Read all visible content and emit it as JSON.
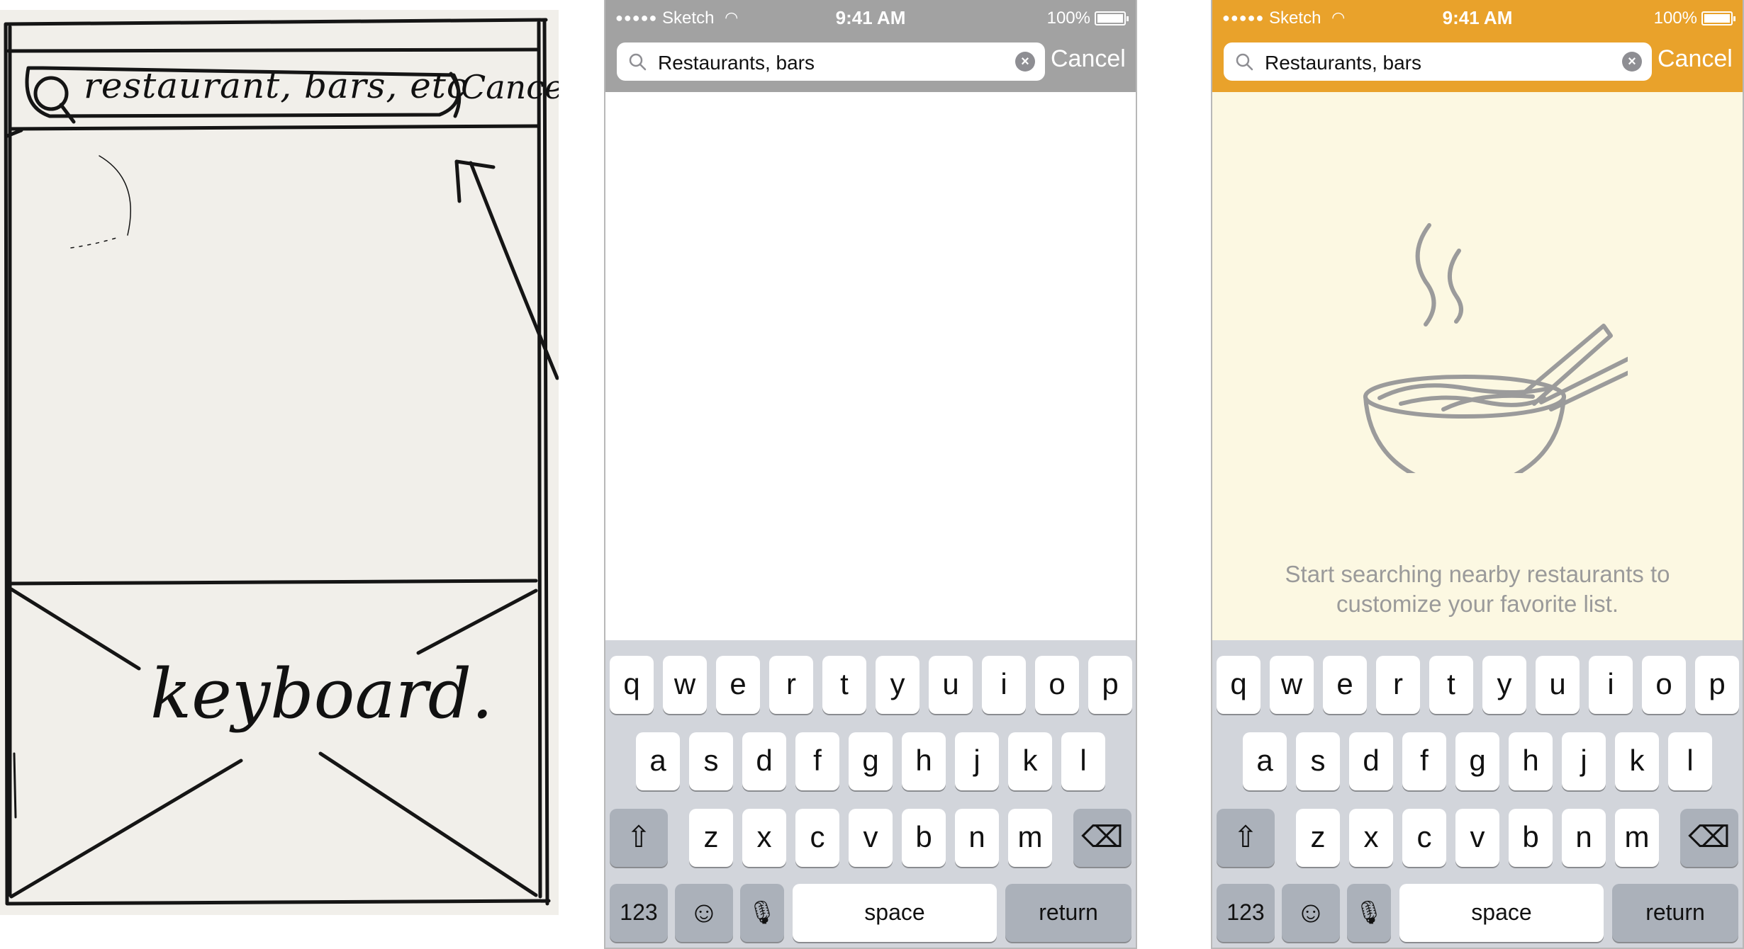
{
  "sketch": {
    "search_text": "restaurant, bars, etc",
    "cancel_text": "Cancel",
    "keyboard_text": "keyboard."
  },
  "screens": {
    "gray": {
      "status": {
        "carrier": "Sketch",
        "signal_dots": "●●●●●",
        "time": "9:41 AM",
        "battery": "100%"
      },
      "search": {
        "value": "Restaurants, bars"
      },
      "cancel_label": "Cancel"
    },
    "orange": {
      "status": {
        "carrier": "Sketch",
        "signal_dots": "●●●●●",
        "time": "9:41 AM",
        "battery": "100%"
      },
      "search": {
        "value": "Restaurants, bars"
      },
      "cancel_label": "Cancel",
      "empty_message_line1": "Start searching nearby restaurants to",
      "empty_message_line2": "customize your favorite list."
    }
  },
  "keyboard": {
    "row1": [
      "q",
      "w",
      "e",
      "r",
      "t",
      "y",
      "u",
      "i",
      "o",
      "p"
    ],
    "row2": [
      "a",
      "s",
      "d",
      "f",
      "g",
      "h",
      "j",
      "k",
      "l"
    ],
    "row3": [
      "z",
      "x",
      "c",
      "v",
      "b",
      "n",
      "m"
    ],
    "shift_glyph": "⇧",
    "delete_glyph": "⌫",
    "numbers_label": "123",
    "emoji_glyph": "☺",
    "mic_glyph": "🎙",
    "space_label": "space",
    "return_label": "return"
  },
  "colors": {
    "gray_header": "#a2a2a2",
    "orange_header": "#e9a22b",
    "orange_content": "#fcf8e2",
    "keyboard_bg": "#d2d5db",
    "illustration_stroke": "#9b9b9b"
  },
  "icons": [
    "search-icon",
    "clear-icon",
    "wifi-icon",
    "battery-icon",
    "shift-icon",
    "delete-icon",
    "emoji-icon",
    "microphone-icon",
    "bowl-illustration"
  ]
}
